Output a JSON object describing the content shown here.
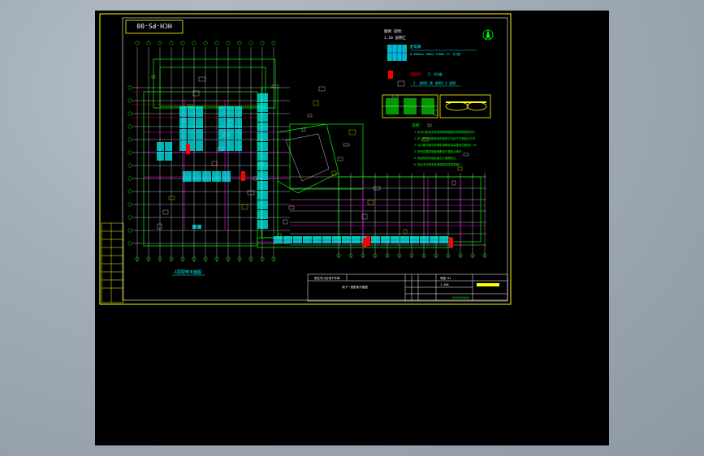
{
  "sheet": {
    "title_tag": "HCH-PS-00",
    "plan_caption": "-1层配电平面图",
    "colors": {
      "background": "#000000",
      "frame": "#ffff00",
      "grid": "#ffffff",
      "wall": "#00ff00",
      "magenta": "#ff00ff",
      "cyan": "#00ffff",
      "red": "#ff0000",
      "blue": "#0000ff"
    }
  },
  "legend": {
    "heading": "图例 说明：",
    "sub": "1.10 说明汇",
    "item1_label": "配电箱",
    "item1_desc": "0.5000kw 100kw 1500m 22. 共1座",
    "item2_label": "电缆桥",
    "item2_desc": "2. 共1座",
    "item3_desc": "2. 说明1.表 说明2.4 说明",
    "notes_heading": "说明：",
    "notes": [
      "1.本设计配电系统说明照明插座用电按照规范执行",
      "2.本工程低压配电采用放射式与树干式相结合方式",
      "3.动力配电箱及照明配电箱安装高度底边距地1.5m",
      "4.所有线路穿钢管暗敷设于楼板及墙内",
      "5.电缆桥架安装高度见平面图标注",
      "6.其余未尽事宜参照国家相关规范施工"
    ]
  },
  "title_block": {
    "project": "某住宅小区地下车库",
    "drawing": "地下一层配电平面图",
    "number": "电施-01",
    "scale": "1:100",
    "remark": "XXXXXXXXXX"
  },
  "icons": {
    "north_arrow": "north-arrow-icon",
    "panel_symbol": "distribution-panel-icon"
  }
}
